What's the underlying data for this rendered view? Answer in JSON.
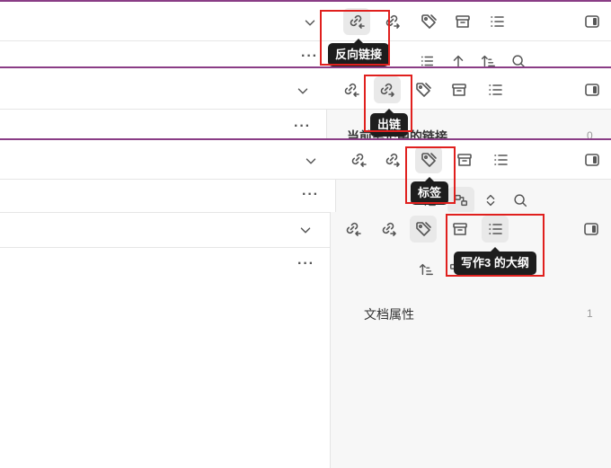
{
  "tooltips": {
    "backlinks": "反向链接",
    "outgoing": "出链",
    "tags": "标签",
    "outline": "写作3 的大纲"
  },
  "panels": {
    "outgoing_section": {
      "title": "当前笔记中的链接",
      "count": "0"
    },
    "properties_section": {
      "title": "文档属性",
      "count": "1"
    }
  },
  "icons": [
    "backlinks-icon",
    "outgoing-links-icon",
    "tag-icon",
    "archive-icon",
    "list-icon",
    "sidebar-toggle-icon",
    "chevron-down-icon",
    "more-icon",
    "sort-icon",
    "upload-icon",
    "search-icon"
  ],
  "colors": {
    "highlight": "#e0201e",
    "tooltip_bg": "#1d1d1d",
    "panel_bg": "#f7f7f7",
    "divider": "#8a3d86"
  }
}
